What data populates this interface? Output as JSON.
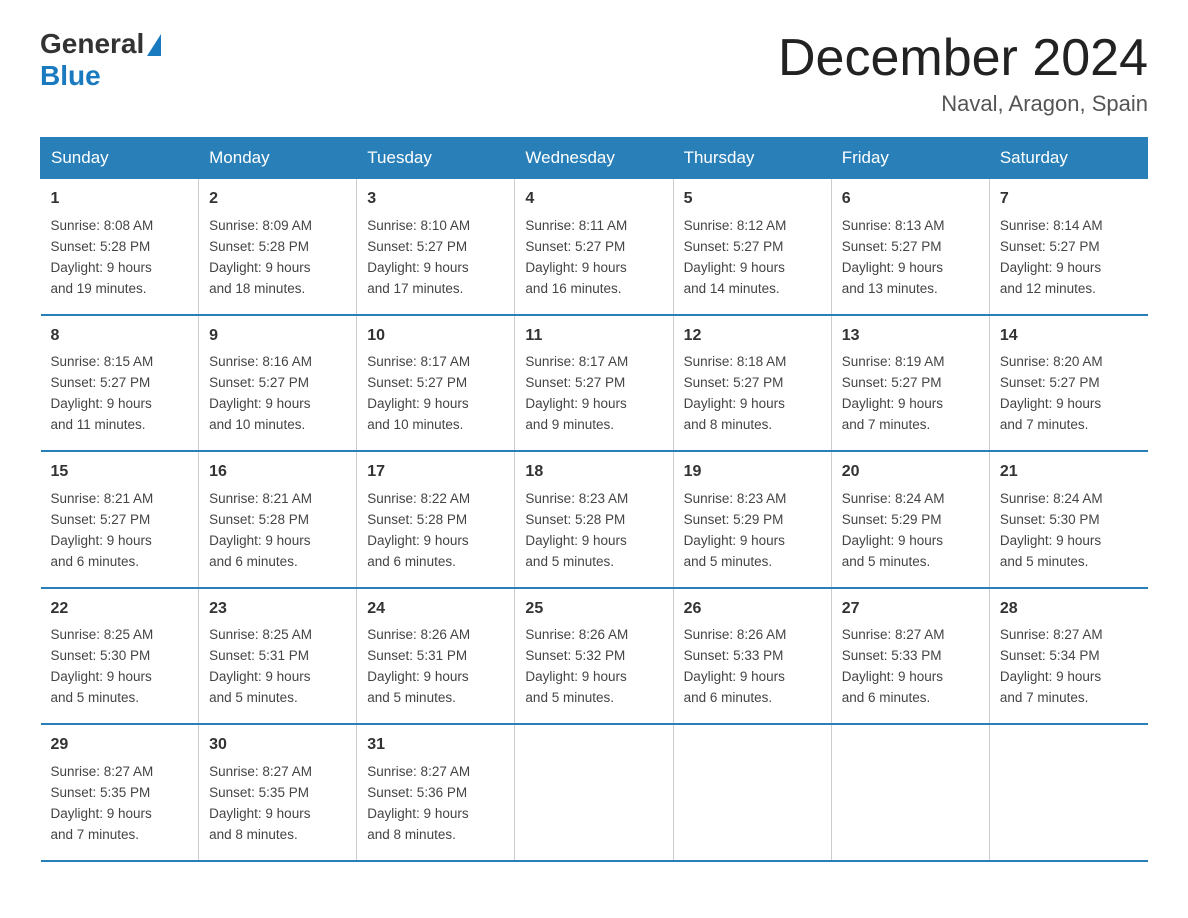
{
  "logo": {
    "general": "General",
    "blue": "Blue"
  },
  "title": "December 2024",
  "subtitle": "Naval, Aragon, Spain",
  "days_of_week": [
    "Sunday",
    "Monday",
    "Tuesday",
    "Wednesday",
    "Thursday",
    "Friday",
    "Saturday"
  ],
  "weeks": [
    [
      {
        "day": "1",
        "sunrise": "8:08 AM",
        "sunset": "5:28 PM",
        "daylight": "9 hours and 19 minutes."
      },
      {
        "day": "2",
        "sunrise": "8:09 AM",
        "sunset": "5:28 PM",
        "daylight": "9 hours and 18 minutes."
      },
      {
        "day": "3",
        "sunrise": "8:10 AM",
        "sunset": "5:27 PM",
        "daylight": "9 hours and 17 minutes."
      },
      {
        "day": "4",
        "sunrise": "8:11 AM",
        "sunset": "5:27 PM",
        "daylight": "9 hours and 16 minutes."
      },
      {
        "day": "5",
        "sunrise": "8:12 AM",
        "sunset": "5:27 PM",
        "daylight": "9 hours and 14 minutes."
      },
      {
        "day": "6",
        "sunrise": "8:13 AM",
        "sunset": "5:27 PM",
        "daylight": "9 hours and 13 minutes."
      },
      {
        "day": "7",
        "sunrise": "8:14 AM",
        "sunset": "5:27 PM",
        "daylight": "9 hours and 12 minutes."
      }
    ],
    [
      {
        "day": "8",
        "sunrise": "8:15 AM",
        "sunset": "5:27 PM",
        "daylight": "9 hours and 11 minutes."
      },
      {
        "day": "9",
        "sunrise": "8:16 AM",
        "sunset": "5:27 PM",
        "daylight": "9 hours and 10 minutes."
      },
      {
        "day": "10",
        "sunrise": "8:17 AM",
        "sunset": "5:27 PM",
        "daylight": "9 hours and 10 minutes."
      },
      {
        "day": "11",
        "sunrise": "8:17 AM",
        "sunset": "5:27 PM",
        "daylight": "9 hours and 9 minutes."
      },
      {
        "day": "12",
        "sunrise": "8:18 AM",
        "sunset": "5:27 PM",
        "daylight": "9 hours and 8 minutes."
      },
      {
        "day": "13",
        "sunrise": "8:19 AM",
        "sunset": "5:27 PM",
        "daylight": "9 hours and 7 minutes."
      },
      {
        "day": "14",
        "sunrise": "8:20 AM",
        "sunset": "5:27 PM",
        "daylight": "9 hours and 7 minutes."
      }
    ],
    [
      {
        "day": "15",
        "sunrise": "8:21 AM",
        "sunset": "5:27 PM",
        "daylight": "9 hours and 6 minutes."
      },
      {
        "day": "16",
        "sunrise": "8:21 AM",
        "sunset": "5:28 PM",
        "daylight": "9 hours and 6 minutes."
      },
      {
        "day": "17",
        "sunrise": "8:22 AM",
        "sunset": "5:28 PM",
        "daylight": "9 hours and 6 minutes."
      },
      {
        "day": "18",
        "sunrise": "8:23 AM",
        "sunset": "5:28 PM",
        "daylight": "9 hours and 5 minutes."
      },
      {
        "day": "19",
        "sunrise": "8:23 AM",
        "sunset": "5:29 PM",
        "daylight": "9 hours and 5 minutes."
      },
      {
        "day": "20",
        "sunrise": "8:24 AM",
        "sunset": "5:29 PM",
        "daylight": "9 hours and 5 minutes."
      },
      {
        "day": "21",
        "sunrise": "8:24 AM",
        "sunset": "5:30 PM",
        "daylight": "9 hours and 5 minutes."
      }
    ],
    [
      {
        "day": "22",
        "sunrise": "8:25 AM",
        "sunset": "5:30 PM",
        "daylight": "9 hours and 5 minutes."
      },
      {
        "day": "23",
        "sunrise": "8:25 AM",
        "sunset": "5:31 PM",
        "daylight": "9 hours and 5 minutes."
      },
      {
        "day": "24",
        "sunrise": "8:26 AM",
        "sunset": "5:31 PM",
        "daylight": "9 hours and 5 minutes."
      },
      {
        "day": "25",
        "sunrise": "8:26 AM",
        "sunset": "5:32 PM",
        "daylight": "9 hours and 5 minutes."
      },
      {
        "day": "26",
        "sunrise": "8:26 AM",
        "sunset": "5:33 PM",
        "daylight": "9 hours and 6 minutes."
      },
      {
        "day": "27",
        "sunrise": "8:27 AM",
        "sunset": "5:33 PM",
        "daylight": "9 hours and 6 minutes."
      },
      {
        "day": "28",
        "sunrise": "8:27 AM",
        "sunset": "5:34 PM",
        "daylight": "9 hours and 7 minutes."
      }
    ],
    [
      {
        "day": "29",
        "sunrise": "8:27 AM",
        "sunset": "5:35 PM",
        "daylight": "9 hours and 7 minutes."
      },
      {
        "day": "30",
        "sunrise": "8:27 AM",
        "sunset": "5:35 PM",
        "daylight": "9 hours and 8 minutes."
      },
      {
        "day": "31",
        "sunrise": "8:27 AM",
        "sunset": "5:36 PM",
        "daylight": "9 hours and 8 minutes."
      },
      null,
      null,
      null,
      null
    ]
  ]
}
